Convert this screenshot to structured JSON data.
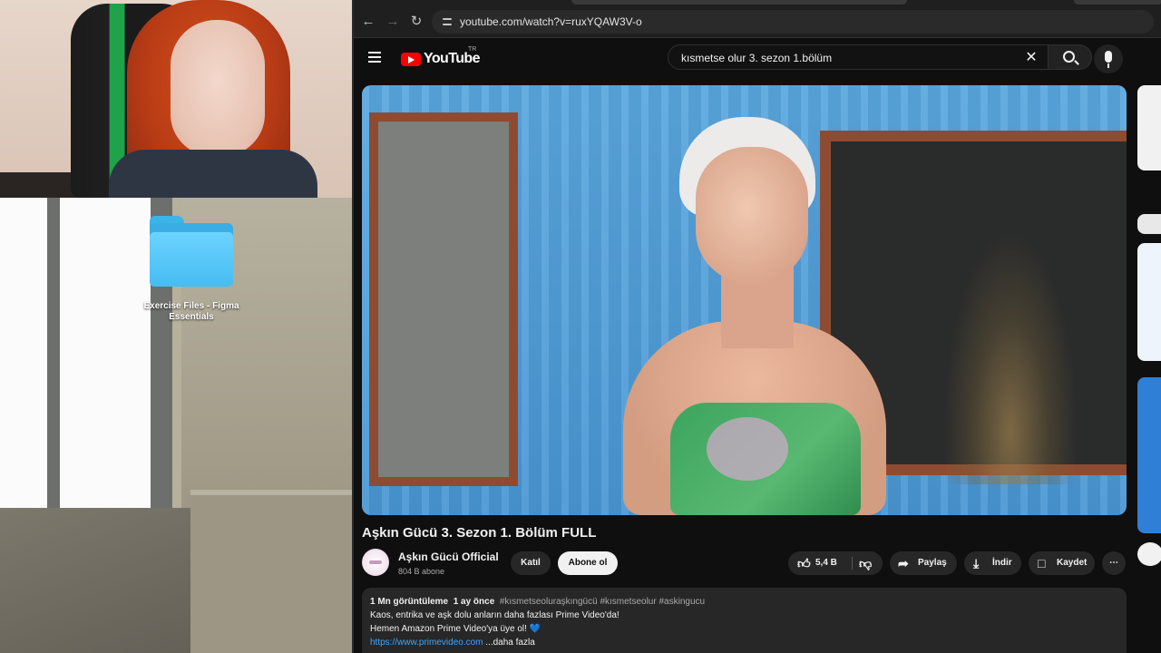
{
  "desktop": {
    "folder_label": "Exercise Files - Figma Essentials"
  },
  "browser": {
    "url": "youtube.com/watch?v=ruxYQAW3V-o"
  },
  "youtube": {
    "logo_text": "YouTube",
    "region": "TR",
    "search_query": "kısmetse olur 3. sezon 1.bölüm",
    "video": {
      "title": "Aşkın Gücü 3. Sezon 1. Bölüm FULL",
      "channel_name": "Aşkın Gücü Official",
      "subscribers": "804 B abone",
      "join_label": "Katıl",
      "subscribe_label": "Abone ol",
      "likes": "5,4 B",
      "share_label": "Paylaş",
      "download_label": "İndir",
      "save_label": "Kaydet"
    },
    "description": {
      "views": "1 Mn görüntüleme",
      "age": "1 ay önce",
      "hashtags": "#kısmetseoluraşkıngücü #kısmetseolur #askingucu",
      "line1": "Kaos, entrika ve aşk dolu anların daha fazlası Prime Video'da!",
      "line2": "Hemen Amazon Prime Video'ya üye ol!",
      "heart": "💙",
      "link": "https://www.primevideo.com",
      "more": "...daha fazla"
    }
  }
}
